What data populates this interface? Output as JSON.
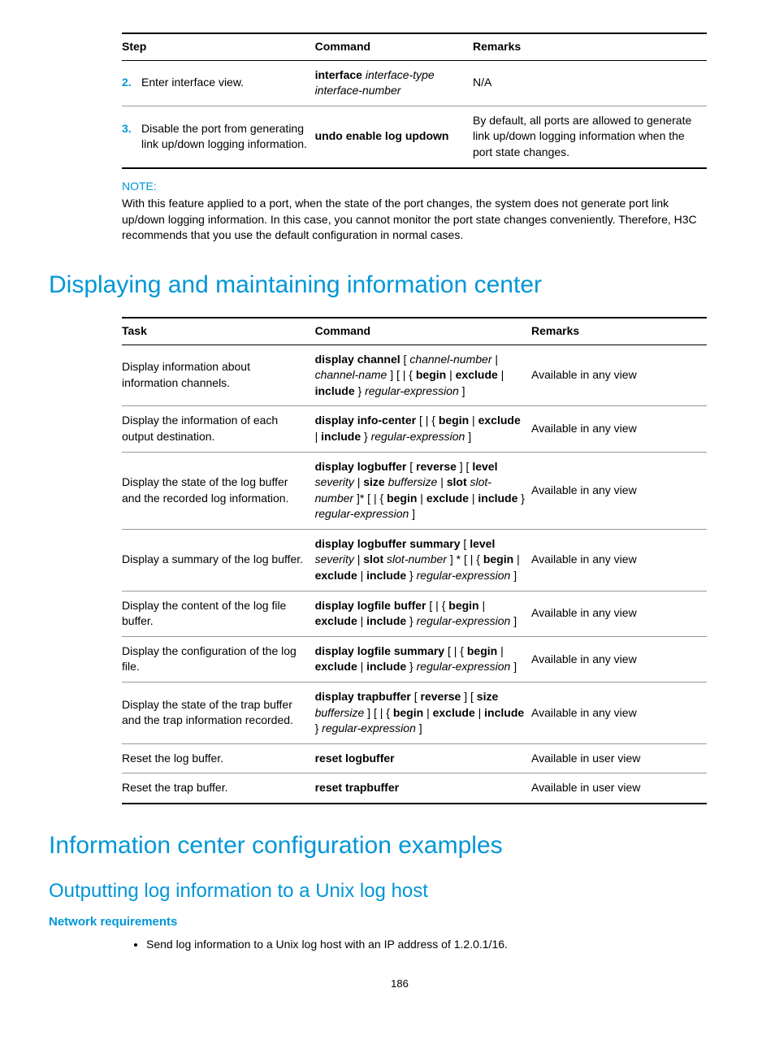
{
  "table1": {
    "headers": [
      "Step",
      "Command",
      "Remarks"
    ],
    "rows": [
      {
        "num": "2.",
        "step": "Enter interface view.",
        "cmd_parts": [
          {
            "t": "interface",
            "b": true,
            "i": false
          },
          {
            "t": " interface-type interface-number",
            "b": false,
            "i": true
          }
        ],
        "remarks": "N/A"
      },
      {
        "num": "3.",
        "step": "Disable the port from generating link up/down logging information.",
        "cmd_parts": [
          {
            "t": "undo enable log updown",
            "b": true,
            "i": false
          }
        ],
        "remarks": "By default, all ports are allowed to generate link up/down logging information when the port state changes."
      }
    ]
  },
  "note": {
    "label": "NOTE:",
    "text": "With this feature applied to a port, when the state of the port changes, the system does not generate port link up/down logging information. In this case, you cannot monitor the port state changes conveniently. Therefore, H3C recommends that you use the default configuration in normal cases."
  },
  "h1a": "Displaying and maintaining information center",
  "table2": {
    "headers": [
      "Task",
      "Command",
      "Remarks"
    ],
    "rows": [
      {
        "task": "Display information about information channels.",
        "cmd": [
          {
            "t": "display channel",
            "b": true
          },
          {
            "t": " [ ",
            "b": false
          },
          {
            "t": "channel-number",
            "i": true
          },
          {
            "t": " | ",
            "b": false
          },
          {
            "t": "channel-name",
            "i": true
          },
          {
            "t": " ] [ | { ",
            "b": false
          },
          {
            "t": "begin",
            "b": true
          },
          {
            "t": " | ",
            "b": false
          },
          {
            "t": "exclude",
            "b": true
          },
          {
            "t": " | ",
            "b": false
          },
          {
            "t": "include",
            "b": true
          },
          {
            "t": " } ",
            "b": false
          },
          {
            "t": "regular-expression",
            "i": true
          },
          {
            "t": " ]",
            "b": false
          }
        ],
        "remarks": "Available in any view"
      },
      {
        "task": "Display the information of each output destination.",
        "cmd": [
          {
            "t": "display info-center",
            "b": true
          },
          {
            "t": " [ | { ",
            "b": false
          },
          {
            "t": "begin",
            "b": true
          },
          {
            "t": " | ",
            "b": false
          },
          {
            "t": "exclude",
            "b": true
          },
          {
            "t": " | ",
            "b": false
          },
          {
            "t": "include",
            "b": true
          },
          {
            "t": " } ",
            "b": false
          },
          {
            "t": "regular-expression",
            "i": true
          },
          {
            "t": " ]",
            "b": false
          }
        ],
        "remarks": "Available in any view"
      },
      {
        "task": "Display the state of the log buffer and the recorded log information.",
        "cmd": [
          {
            "t": "display logbuffer",
            "b": true
          },
          {
            "t": " [ ",
            "b": false
          },
          {
            "t": "reverse",
            "b": true
          },
          {
            "t": " ] [ ",
            "b": false
          },
          {
            "t": "level",
            "b": true
          },
          {
            "t": " ",
            "b": false
          },
          {
            "t": "severity",
            "i": true
          },
          {
            "t": " | ",
            "b": false
          },
          {
            "t": "size",
            "b": true
          },
          {
            "t": " ",
            "b": false
          },
          {
            "t": "buffersize",
            "i": true
          },
          {
            "t": " | ",
            "b": false
          },
          {
            "t": "slot",
            "b": true
          },
          {
            "t": " ",
            "b": false
          },
          {
            "t": "slot-number",
            "i": true
          },
          {
            "t": " ]* [ | { ",
            "b": false
          },
          {
            "t": "begin",
            "b": true
          },
          {
            "t": " | ",
            "b": false
          },
          {
            "t": "exclude",
            "b": true
          },
          {
            "t": " | ",
            "b": false
          },
          {
            "t": "include",
            "b": true
          },
          {
            "t": " } ",
            "b": false
          },
          {
            "t": "regular-expression",
            "i": true
          },
          {
            "t": " ]",
            "b": false
          }
        ],
        "remarks": "Available in any view"
      },
      {
        "task": "Display a summary of the log buffer.",
        "cmd": [
          {
            "t": "display logbuffer summary",
            "b": true
          },
          {
            "t": " [ ",
            "b": false
          },
          {
            "t": "level",
            "b": true
          },
          {
            "t": " ",
            "b": false
          },
          {
            "t": "severity",
            "i": true
          },
          {
            "t": " | ",
            "b": false
          },
          {
            "t": "slot",
            "b": true
          },
          {
            "t": " ",
            "b": false
          },
          {
            "t": "slot-number",
            "i": true
          },
          {
            "t": " ] * [ | { ",
            "b": false
          },
          {
            "t": "begin",
            "b": true
          },
          {
            "t": " | ",
            "b": false
          },
          {
            "t": "exclude",
            "b": true
          },
          {
            "t": " | ",
            "b": false
          },
          {
            "t": "include",
            "b": true
          },
          {
            "t": " } ",
            "b": false
          },
          {
            "t": "regular-expression",
            "i": true
          },
          {
            "t": " ]",
            "b": false
          }
        ],
        "remarks": "Available in any view"
      },
      {
        "task": "Display the content of the log file buffer.",
        "cmd": [
          {
            "t": "display logfile buffer",
            "b": true
          },
          {
            "t": " [ | { ",
            "b": false
          },
          {
            "t": "begin",
            "b": true
          },
          {
            "t": " | ",
            "b": false
          },
          {
            "t": "exclude",
            "b": true
          },
          {
            "t": " | ",
            "b": false
          },
          {
            "t": "include",
            "b": true
          },
          {
            "t": " } ",
            "b": false
          },
          {
            "t": "regular-expression",
            "i": true
          },
          {
            "t": " ]",
            "b": false
          }
        ],
        "remarks": "Available in any view"
      },
      {
        "task": "Display the configuration of the log file.",
        "cmd": [
          {
            "t": "display logfile summary",
            "b": true
          },
          {
            "t": " [ | { ",
            "b": false
          },
          {
            "t": "begin",
            "b": true
          },
          {
            "t": " | ",
            "b": false
          },
          {
            "t": "exclude",
            "b": true
          },
          {
            "t": " | ",
            "b": false
          },
          {
            "t": "include",
            "b": true
          },
          {
            "t": " } ",
            "b": false
          },
          {
            "t": "regular-expression",
            "i": true
          },
          {
            "t": " ]",
            "b": false
          }
        ],
        "remarks": "Available in any view"
      },
      {
        "task": "Display the state of the trap buffer and the trap information recorded.",
        "cmd": [
          {
            "t": "display trapbuffer",
            "b": true
          },
          {
            "t": " [ ",
            "b": false
          },
          {
            "t": "reverse",
            "b": true
          },
          {
            "t": " ] [ ",
            "b": false
          },
          {
            "t": "size",
            "b": true
          },
          {
            "t": " ",
            "b": false
          },
          {
            "t": "buffersize",
            "i": true
          },
          {
            "t": " ] [ | { ",
            "b": false
          },
          {
            "t": "begin",
            "b": true
          },
          {
            "t": " | ",
            "b": false
          },
          {
            "t": "exclude",
            "b": true
          },
          {
            "t": " | ",
            "b": false
          },
          {
            "t": "include",
            "b": true
          },
          {
            "t": " } ",
            "b": false
          },
          {
            "t": "regular-expression",
            "i": true
          },
          {
            "t": " ]",
            "b": false
          }
        ],
        "remarks": "Available in any view"
      },
      {
        "task": "Reset the log buffer.",
        "cmd": [
          {
            "t": "reset logbuffer",
            "b": true
          }
        ],
        "remarks": "Available in user view"
      },
      {
        "task": "Reset the trap buffer.",
        "cmd": [
          {
            "t": "reset trapbuffer",
            "b": true
          }
        ],
        "remarks": "Available in user view"
      }
    ]
  },
  "h1b": "Information center configuration examples",
  "h2a": "Outputting log information to a Unix log host",
  "h3a": "Network requirements",
  "bullet1": "Send log information to a Unix log host with an IP address of 1.2.0.1/16.",
  "pagenum": "186"
}
